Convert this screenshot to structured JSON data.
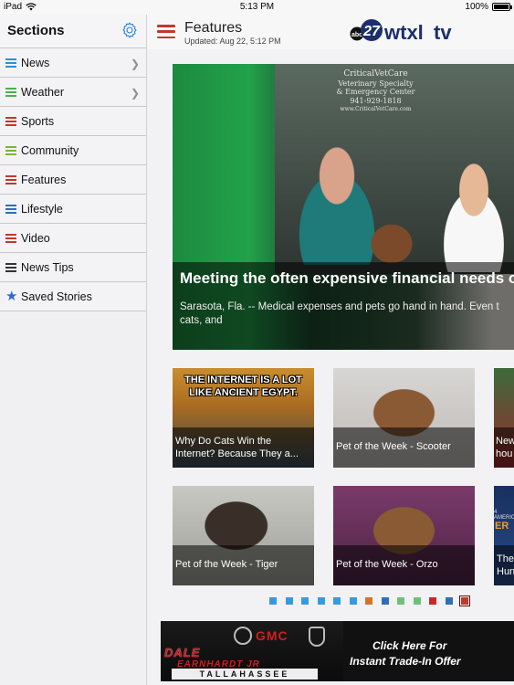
{
  "status_bar": {
    "device": "iPad",
    "time": "5:13 PM",
    "battery": "100%"
  },
  "sidebar": {
    "title": "Sections",
    "items": [
      {
        "label": "News",
        "color": "#2d8fd5",
        "has_chevron": true
      },
      {
        "label": "Weather",
        "color": "#4caf50",
        "has_chevron": true
      },
      {
        "label": "Sports",
        "color": "#c0392b",
        "has_chevron": false
      },
      {
        "label": "Community",
        "color": "#7cb342",
        "has_chevron": false
      },
      {
        "label": "Features",
        "color": "#c0392b",
        "has_chevron": false
      },
      {
        "label": "Lifestyle",
        "color": "#2d6fb5",
        "has_chevron": false
      },
      {
        "label": "Video",
        "color": "#c0392b",
        "has_chevron": false
      },
      {
        "label": "News Tips",
        "color": "#333333",
        "has_chevron": false
      },
      {
        "label": "Saved Stories",
        "color": "#2a6ad6",
        "icon": "star-icon"
      }
    ]
  },
  "header": {
    "title": "Features",
    "updated": "Updated: Aug 22, 5:12 PM",
    "logo": {
      "network": "abc",
      "channel": "27",
      "station": "wtxl",
      "suffix": "tv"
    }
  },
  "hero": {
    "headline": "Meeting the often expensive financial needs o",
    "summary": "Sarasota, Fla. -- Medical expenses and pets go hand in hand. Even t cats, and",
    "sign_text": [
      "CriticalVetCare",
      "Veterinary Specialty",
      "& Emergency Center",
      "941-929-1818",
      "www.CriticalVetCare.com"
    ]
  },
  "tiles": [
    {
      "caption": "Why Do Cats Win the Internet? Because They a...",
      "image_text": "THE INTERNET IS A LOT LIKE ANCIENT EGYPT."
    },
    {
      "caption": "Pet of the Week - Scooter"
    },
    {
      "caption": "New hou"
    },
    {
      "caption": "Pet of the Week - Tiger"
    },
    {
      "caption": "Pet of the Week - Orzo"
    },
    {
      "caption": "The Hun",
      "image_text": "ER",
      "image_subtext": "4 AMERIC"
    }
  ],
  "pager": {
    "dots": [
      "#3a9ad9",
      "#3a9ad9",
      "#3a9ad9",
      "#3a9ad9",
      "#3a9ad9",
      "#3a9ad9",
      "#d4742a",
      "#2f6fb6",
      "#6cc17a",
      "#6cc17a",
      "#c62828",
      "#2f6fb6",
      "#c0392b"
    ],
    "active_index": 12
  },
  "ad": {
    "brand": "GMC",
    "dealer_line1": "DALE",
    "dealer_line2": "EARNHARDT JR",
    "location": "TALLAHASSEE",
    "cta_line1": "Click Here For",
    "cta_line2": "Instant Trade-In Offer"
  }
}
